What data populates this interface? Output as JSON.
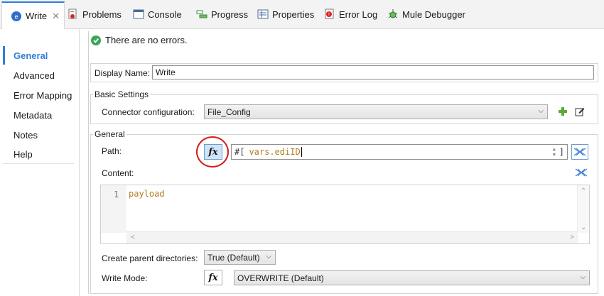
{
  "tabs": [
    {
      "label": "Write",
      "icon": "mule-write-icon",
      "active": true
    },
    {
      "label": "Problems",
      "icon": "problems-icon"
    },
    {
      "label": "Console",
      "icon": "console-icon"
    },
    {
      "label": "Progress",
      "icon": "progress-icon"
    },
    {
      "label": "Properties",
      "icon": "properties-icon"
    },
    {
      "label": "Error Log",
      "icon": "error-log-icon"
    },
    {
      "label": "Mule Debugger",
      "icon": "debugger-icon"
    }
  ],
  "sidebar": {
    "items": [
      {
        "label": "General",
        "active": true
      },
      {
        "label": "Advanced"
      },
      {
        "label": "Error Mapping"
      },
      {
        "label": "Metadata"
      },
      {
        "label": "Notes"
      },
      {
        "label": "Help"
      }
    ]
  },
  "status": {
    "text": "There are no errors."
  },
  "display_name": {
    "label": "Display Name:",
    "value": "Write"
  },
  "basic_settings": {
    "title": "Basic Settings",
    "connector_label": "Connector configuration:",
    "connector_value": "File_Config"
  },
  "general": {
    "title": "General",
    "path_label": "Path:",
    "path_prefix": "#[",
    "path_expr": "vars.ediID",
    "path_suffix": "]",
    "content_label": "Content:",
    "content_line_number": "1",
    "content_code": "payload",
    "create_dirs_label": "Create parent directories:",
    "create_dirs_value": "True (Default)",
    "write_mode_label": "Write Mode:",
    "write_mode_value": "OVERWRITE (Default)"
  },
  "fx_label": "fx",
  "colors": {
    "accent": "#2f7fd6",
    "ok": "#3aa657",
    "highlight_ring": "#d41c1c",
    "keyword": "#b07d1f"
  }
}
